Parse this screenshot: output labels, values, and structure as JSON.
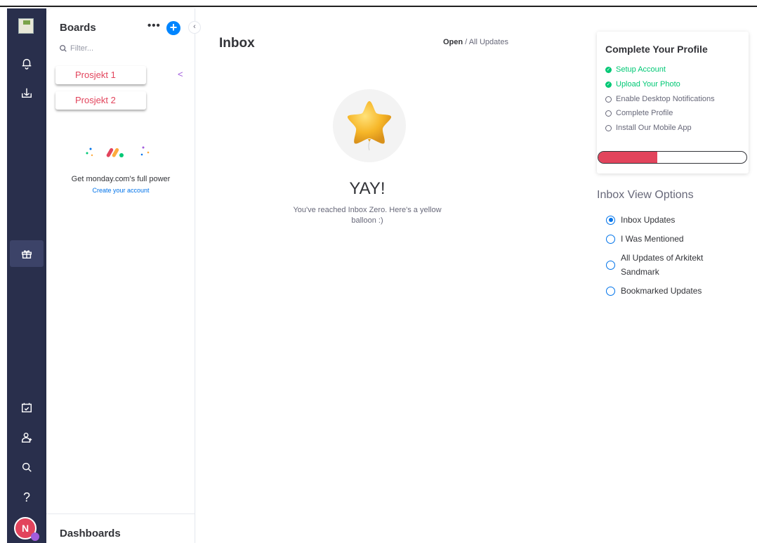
{
  "rail": {
    "icons": [
      "logo-icon",
      "bell-icon",
      "inbox-tray-icon",
      "gift-icon",
      "calendar-check-icon",
      "invite-user-icon",
      "search-icon",
      "help-icon"
    ],
    "avatar_initial": "N"
  },
  "boards_panel": {
    "title": "Boards",
    "more_label": "•••",
    "add_label": "+",
    "collapse_label": "‹",
    "filter_placeholder": "Filter...",
    "items": [
      {
        "label": "Prosjekt 1"
      },
      {
        "label": "Prosjekt 2"
      }
    ],
    "promo_text": "Get monday.com's full power",
    "promo_link": "Create your account",
    "dashboards_label": "Dashboards"
  },
  "main": {
    "title": "Inbox",
    "filter_active": "Open",
    "filter_separator": " / ",
    "filter_other": "All Updates",
    "empty_title": "YAY!",
    "empty_text": "You've reached Inbox Zero. Here's a yellow balloon :)"
  },
  "profile": {
    "title": "Complete Your Profile",
    "steps": [
      {
        "label": "Setup Account",
        "done": true
      },
      {
        "label": "Upload Your Photo",
        "done": true
      },
      {
        "label": "Enable Desktop Notifications",
        "done": false
      },
      {
        "label": "Complete Profile",
        "done": false
      },
      {
        "label": "Install Our Mobile App",
        "done": false
      }
    ],
    "progress_fraction": 0.4,
    "progress_color": "#e2445c"
  },
  "view_options": {
    "title": "Inbox View Options",
    "options": [
      {
        "label": "Inbox Updates",
        "selected": true
      },
      {
        "label": "I Was Mentioned",
        "selected": false
      },
      {
        "label": "All Updates of Arkitekt Sandmark",
        "selected": false
      },
      {
        "label": "Bookmarked Updates",
        "selected": false
      }
    ]
  },
  "colors": {
    "rail_bg": "#292f4c",
    "accent_blue": "#0073ea",
    "done_green": "#00c875",
    "board_red": "#e2445c"
  }
}
